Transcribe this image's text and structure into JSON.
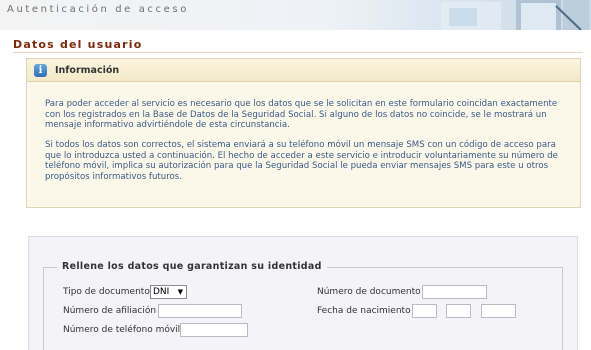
{
  "banner": {
    "title": "Autenticación de acceso"
  },
  "section": {
    "title": "Datos del usuario"
  },
  "info": {
    "icon": "info-icon",
    "title": "Información",
    "paragraph1": "Para poder acceder al servicio es necesario que los datos que se le solicitan en este formulario coincidan exactamente con los registrados en la Base de Datos de la Seguridad Social. Si alguno de los datos no coincide, se le mostrará un mensaje informativo advirtiéndole de esta circunstancia.",
    "paragraph2": "Si todos los datos son correctos, el sistema enviará a su teléfono móvil un mensaje SMS con un código de acceso para que lo introduzca usted a continuación. El hecho de acceder a este servicio e introducir voluntariamente su número de teléfono móvil, implica su autorización para que la Seguridad Social le pueda enviar mensajes SMS para este u otros propósitos informativos futuros."
  },
  "form": {
    "legend": "Rellene los datos que garantizan su identidad",
    "tipo_documento_label": "Tipo de documento",
    "tipo_documento_value": "DNI",
    "numero_afiliacion_label": "Número de afiliación",
    "numero_telefono_label": "Número de teléfono móvil",
    "numero_documento_label": "Número de documento",
    "fecha_nacimiento_label": "Fecha de nacimiento"
  },
  "colors": {
    "title": "#7a2a0a",
    "info_bg": "#fbf8ea",
    "info_text": "#3a5a8a",
    "form_bg": "#f4f4f8"
  }
}
